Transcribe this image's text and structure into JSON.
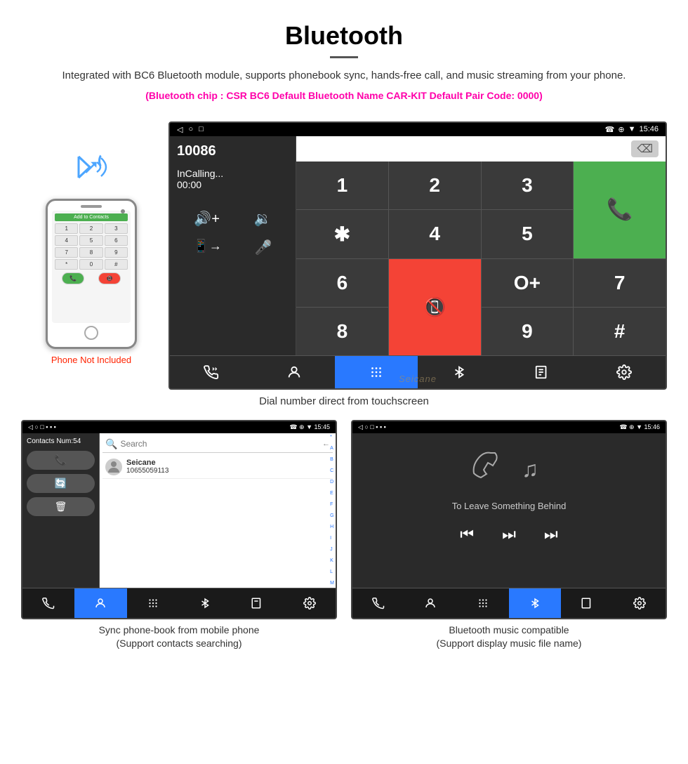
{
  "header": {
    "title": "Bluetooth",
    "description": "Integrated with BC6 Bluetooth module, supports phonebook sync, hands-free call, and music streaming from your phone.",
    "spec_line": "(Bluetooth chip : CSR BC6    Default Bluetooth Name CAR-KIT    Default Pair Code: 0000)"
  },
  "phone_mockup": {
    "add_to_contacts": "Add to Contacts",
    "keys": [
      "1",
      "2",
      "3",
      "4",
      "5",
      "6",
      "*",
      "0",
      "#"
    ]
  },
  "phone_not_included": "Phone Not Included",
  "car_screen": {
    "status_bar": {
      "left_icons": "◁  ○  □",
      "right_icons": "☎  ⊕  ▼  15:46"
    },
    "caller_number": "10086",
    "caller_status": "InCalling...",
    "caller_time": "00:00",
    "keypad": [
      "1",
      "2",
      "3",
      "*",
      "4",
      "5",
      "6",
      "0+",
      "7",
      "8",
      "9",
      "#"
    ],
    "call_btn": "📞",
    "end_btn": "📞"
  },
  "main_caption": "Dial number direct from touchscreen",
  "phonebook_screen": {
    "status_left": "◁  ○  □",
    "status_right": "☎  ⊕  ▼  15:45",
    "contacts_num": "Contacts Num:54",
    "contact_name": "Seicane",
    "contact_number": "10655059113",
    "search_placeholder": "Search",
    "alpha_list": [
      "*",
      "A",
      "B",
      "C",
      "D",
      "E",
      "F",
      "G",
      "H",
      "I",
      "J",
      "K",
      "L",
      "M"
    ]
  },
  "phonebook_caption": {
    "line1": "Sync phone-book from mobile phone",
    "line2": "(Support contacts searching)"
  },
  "music_screen": {
    "status_left": "◁  ○  □",
    "status_right": "☎  ⊕  ▼  15:46",
    "track_title": "To Leave Something Behind"
  },
  "music_caption": {
    "line1": "Bluetooth music compatible",
    "line2": "(Support display music file name)"
  },
  "bottom_nav_items": [
    "📞",
    "👤",
    "⠿",
    "✱",
    "📋",
    "⚙"
  ],
  "seicane": "Seicane"
}
